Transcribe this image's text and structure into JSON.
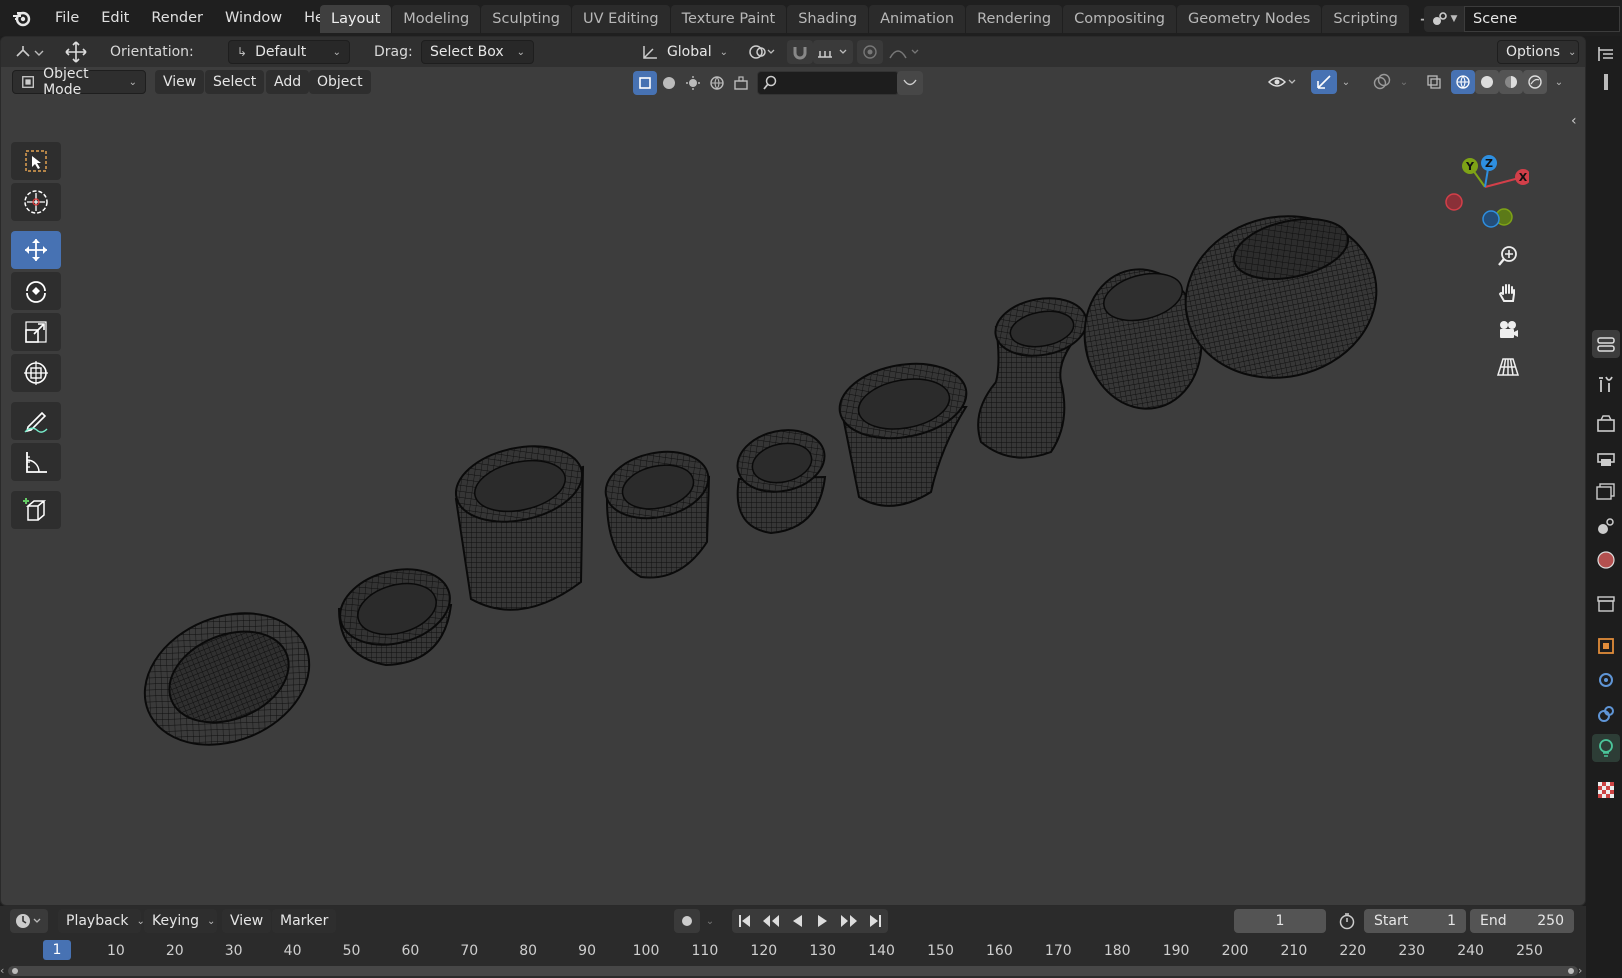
{
  "topbar": {
    "menus": [
      "File",
      "Edit",
      "Render",
      "Window",
      "Help"
    ],
    "tabs": [
      {
        "label": "Layout",
        "active": true
      },
      {
        "label": "Modeling"
      },
      {
        "label": "Sculpting"
      },
      {
        "label": "UV Editing"
      },
      {
        "label": "Texture Paint"
      },
      {
        "label": "Shading"
      },
      {
        "label": "Animation"
      },
      {
        "label": "Rendering"
      },
      {
        "label": "Compositing"
      },
      {
        "label": "Geometry Nodes"
      },
      {
        "label": "Scripting"
      }
    ],
    "add_tab": "+",
    "scene_name": "Scene"
  },
  "viewport_header": {
    "orientation_label": "Orientation:",
    "orientation_value": "Default",
    "drag_label": "Drag:",
    "drag_value": "Select Box",
    "transform_space": "Global",
    "options_label": "Options"
  },
  "mode_header": {
    "mode": "Object Mode",
    "menus": [
      "View",
      "Select",
      "Add",
      "Object"
    ],
    "search_placeholder": ""
  },
  "tools": [
    "select-box",
    "cursor",
    "move",
    "rotate",
    "scale",
    "transform",
    "annotate",
    "measure",
    "add-cube"
  ],
  "active_tool": "move",
  "gizmo": {
    "x": "X",
    "y": "Y",
    "z": "Z",
    "colors": {
      "x": "#d33f49",
      "y": "#7ea316",
      "z": "#2e8fe0"
    }
  },
  "timeline": {
    "menus": [
      "Playback",
      "Keying",
      "View",
      "Marker"
    ],
    "current_frame": "1",
    "start_label": "Start",
    "start_value": "1",
    "end_label": "End",
    "end_value": "250",
    "ruler_current": "1",
    "ruler_ticks": [
      "10",
      "20",
      "30",
      "40",
      "50",
      "60",
      "70",
      "80",
      "90",
      "100",
      "110",
      "120",
      "130",
      "140",
      "150",
      "160",
      "170",
      "180",
      "190",
      "200",
      "210",
      "220",
      "230",
      "240",
      "250"
    ]
  },
  "colors": {
    "accent": "#4772b3",
    "viewport": "#3d3d3d",
    "wire": "#0c0c0c"
  }
}
